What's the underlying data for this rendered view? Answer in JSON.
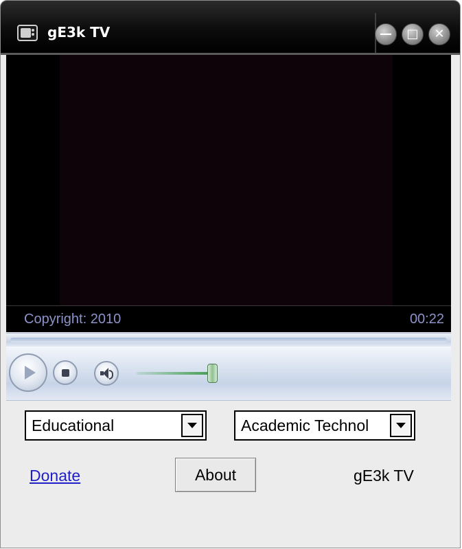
{
  "window": {
    "title": "gE3k TV",
    "minimize_symbol": "—",
    "maximize_symbol": "□",
    "close_symbol": "✕"
  },
  "status": {
    "copyright": "Copyright: 2010",
    "time": "00:22"
  },
  "selectors": {
    "category": "Educational",
    "channel": "Academic Technol"
  },
  "links": {
    "donate": "Donate"
  },
  "buttons": {
    "about": "About"
  },
  "footer": {
    "app_name": "gE3k TV"
  },
  "icons": {
    "app": "tv-icon",
    "play": "play-icon",
    "stop": "stop-icon",
    "mute": "speaker-icon"
  },
  "colors": {
    "titlebar": "#000000",
    "status_text": "#8c93c8",
    "link": "#1f1fc8",
    "volume_accent": "#3f9d4b"
  }
}
